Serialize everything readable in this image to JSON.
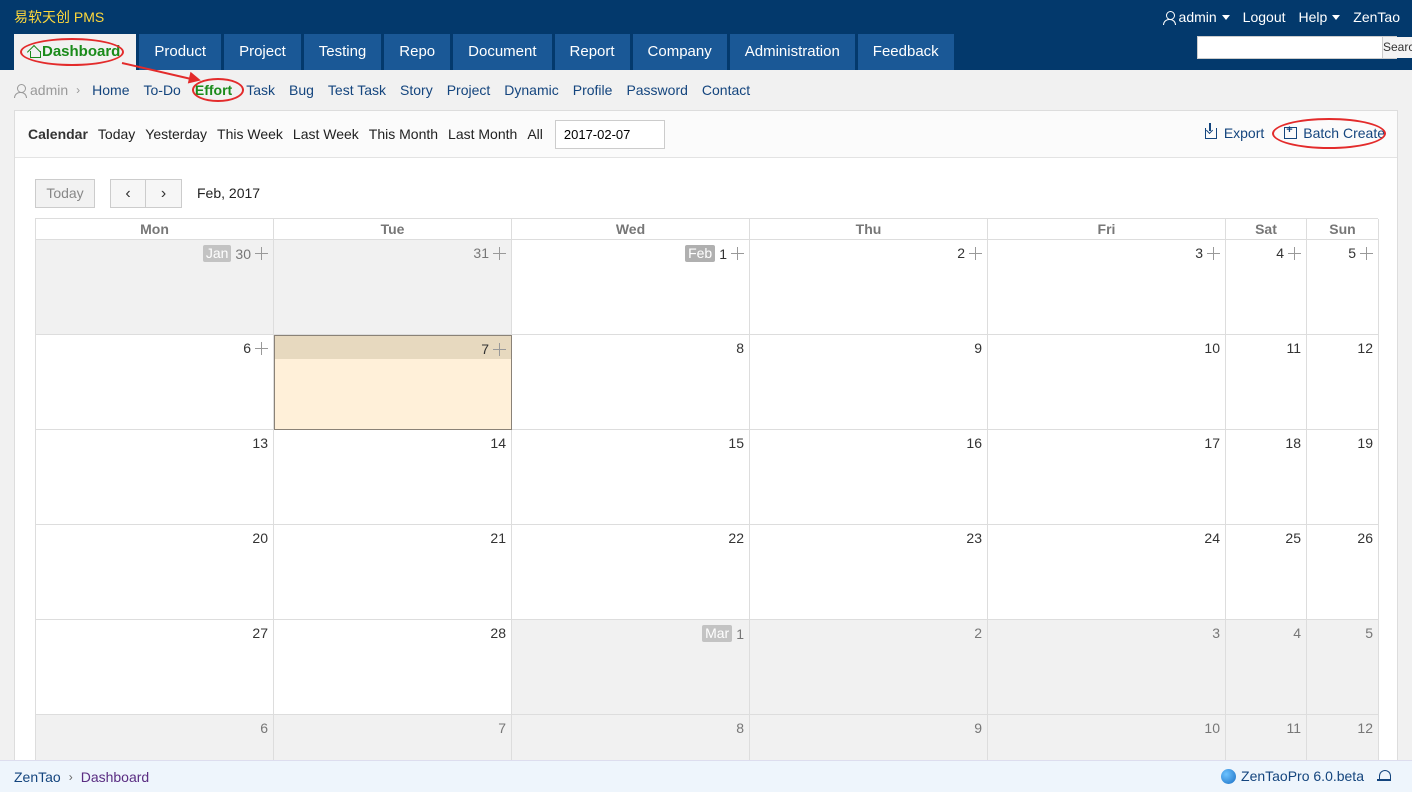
{
  "header": {
    "brand": "易软天创 PMS",
    "user_menu": "admin",
    "logout": "Logout",
    "help": "Help",
    "zentao": "ZenTao",
    "search_button": "Search",
    "search_placeholder": ""
  },
  "main_nav": [
    "Dashboard",
    "Product",
    "Project",
    "Testing",
    "Repo",
    "Document",
    "Report",
    "Company",
    "Administration",
    "Feedback"
  ],
  "sub_nav": {
    "user": "admin",
    "items": [
      "Home",
      "To-Do",
      "Effort",
      "Task",
      "Bug",
      "Test Task",
      "Story",
      "Project",
      "Dynamic",
      "Profile",
      "Password",
      "Contact"
    ],
    "active": "Effort"
  },
  "toolbar": {
    "label": "Calendar",
    "filters": [
      "Today",
      "Yesterday",
      "This Week",
      "Last Week",
      "This Month",
      "Last Month",
      "All"
    ],
    "date_value": "2017-02-07",
    "export": "Export",
    "batch_create": "Batch Create"
  },
  "calendar": {
    "today_button": "Today",
    "prev": "‹",
    "next": "›",
    "month_title": "Feb, 2017",
    "weekdays": [
      "Mon",
      "Tue",
      "Wed",
      "Thu",
      "Fri",
      "Sat",
      "Sun"
    ],
    "weeks": [
      [
        {
          "day": "30",
          "tag": "Jan",
          "other": true,
          "add": true
        },
        {
          "day": "31",
          "other": true,
          "add": true
        },
        {
          "day": "1",
          "tag": "Feb",
          "add": true
        },
        {
          "day": "2",
          "add": true
        },
        {
          "day": "3",
          "add": true
        },
        {
          "day": "4",
          "add": true
        },
        {
          "day": "5",
          "add": true
        }
      ],
      [
        {
          "day": "6",
          "add": true
        },
        {
          "day": "7",
          "today": true,
          "add": true
        },
        {
          "day": "8"
        },
        {
          "day": "9"
        },
        {
          "day": "10"
        },
        {
          "day": "11"
        },
        {
          "day": "12"
        }
      ],
      [
        {
          "day": "13"
        },
        {
          "day": "14"
        },
        {
          "day": "15"
        },
        {
          "day": "16"
        },
        {
          "day": "17"
        },
        {
          "day": "18"
        },
        {
          "day": "19"
        }
      ],
      [
        {
          "day": "20"
        },
        {
          "day": "21"
        },
        {
          "day": "22"
        },
        {
          "day": "23"
        },
        {
          "day": "24"
        },
        {
          "day": "25"
        },
        {
          "day": "26"
        }
      ],
      [
        {
          "day": "27"
        },
        {
          "day": "28"
        },
        {
          "day": "1",
          "tag": "Mar",
          "other": true
        },
        {
          "day": "2",
          "other": true
        },
        {
          "day": "3",
          "other": true
        },
        {
          "day": "4",
          "other": true
        },
        {
          "day": "5",
          "other": true
        }
      ],
      [
        {
          "day": "6",
          "other": true
        },
        {
          "day": "7",
          "other": true
        },
        {
          "day": "8",
          "other": true
        },
        {
          "day": "9",
          "other": true
        },
        {
          "day": "10",
          "other": true
        },
        {
          "day": "11",
          "other": true
        },
        {
          "day": "12",
          "other": true
        }
      ]
    ]
  },
  "footer": {
    "home": "ZenTao",
    "current": "Dashboard",
    "version": "ZenTaoPro 6.0.beta"
  },
  "colors": {
    "header_bg": "#03396c",
    "nav_bg": "#1a5896",
    "active_green": "#1a8b1a",
    "annotation_red": "#e32b2b",
    "today_bg": "#fff0d9"
  }
}
